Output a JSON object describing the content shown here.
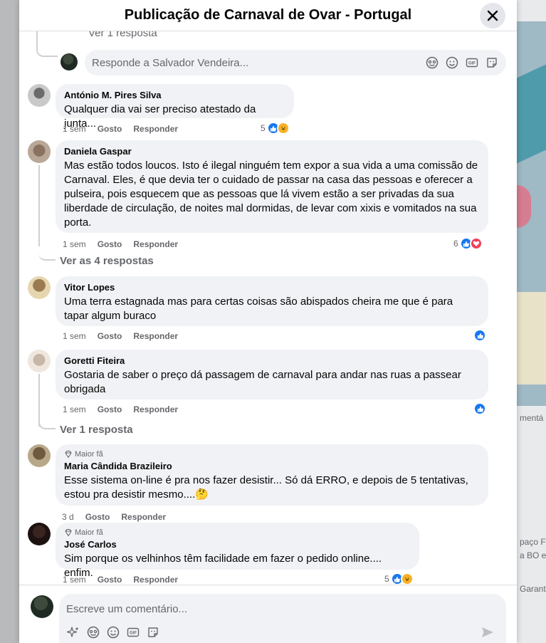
{
  "modal": {
    "title": "Publicação de Carnaval de Ovar - Portugal"
  },
  "reply_box": {
    "placeholder": "Responde a Salvador Vendeira...",
    "partial_top_link": "Ver 1 resposta"
  },
  "comments": [
    {
      "author": "António M. Pires Silva",
      "text": "Qualquer dia vai ser preciso atestado da junta...",
      "time": "1 sem",
      "like_label": "Gosto",
      "reply_label": "Responder",
      "reaction_count": "5",
      "reactions": [
        "like",
        "haha"
      ]
    },
    {
      "author": "Daniela Gaspar",
      "text": "Mas estão todos loucos. Isto é ilegal ninguém tem expor a sua vida a uma comissão de Carnaval. Eles, é que devia ter o cuidado de passar na casa das pessoas e oferecer a pulseira, pois esquecem que as pessoas que lá vivem estão a ser privadas da sua liberdade de circulação, de noites mal dormidas, de levar com xixis e vomitados na sua porta.",
      "time": "1 sem",
      "like_label": "Gosto",
      "reply_label": "Responder",
      "reaction_count": "6",
      "reactions": [
        "like",
        "love"
      ],
      "view_replies": "Ver as 4 respostas"
    },
    {
      "author": "Vitor Lopes",
      "text": "Uma terra estagnada mas para certas coisas são abispados cheira me que é para tapar algum buraco",
      "time": "1 sem",
      "like_label": "Gosto",
      "reply_label": "Responder",
      "reaction_count": "",
      "reactions": [
        "like"
      ]
    },
    {
      "author": "Goretti Fiteira",
      "text": "Gostaria de saber o preço dá passagem de carnaval para andar nas ruas a passear obrigada",
      "time": "1 sem",
      "like_label": "Gosto",
      "reply_label": "Responder",
      "reaction_count": "",
      "reactions": [
        "like"
      ],
      "view_replies": "Ver 1 resposta"
    },
    {
      "badge": "Maior fã",
      "author": "Maria Cândida Brazileiro",
      "text": "Esse sistema on-line é pra nos fazer desistir... Só dá ERRO, e depois de 5 tentativas, estou pra desistir mesmo....🤔",
      "time": "3 d",
      "like_label": "Gosto",
      "reply_label": "Responder"
    },
    {
      "badge": "Maior fã",
      "author": "José Carlos",
      "text": "Sim porque os velhinhos têm facilidade em fazer o pedido online.... enfim.",
      "time": "1 sem",
      "like_label": "Gosto",
      "reply_label": "Responder",
      "reaction_count": "5",
      "reactions": [
        "like",
        "haha"
      ]
    }
  ],
  "composer": {
    "placeholder": "Escreve um comentário..."
  },
  "background": {
    "partial_texts": [
      "mentá",
      "paço F",
      "a BO e",
      "Garant"
    ]
  }
}
